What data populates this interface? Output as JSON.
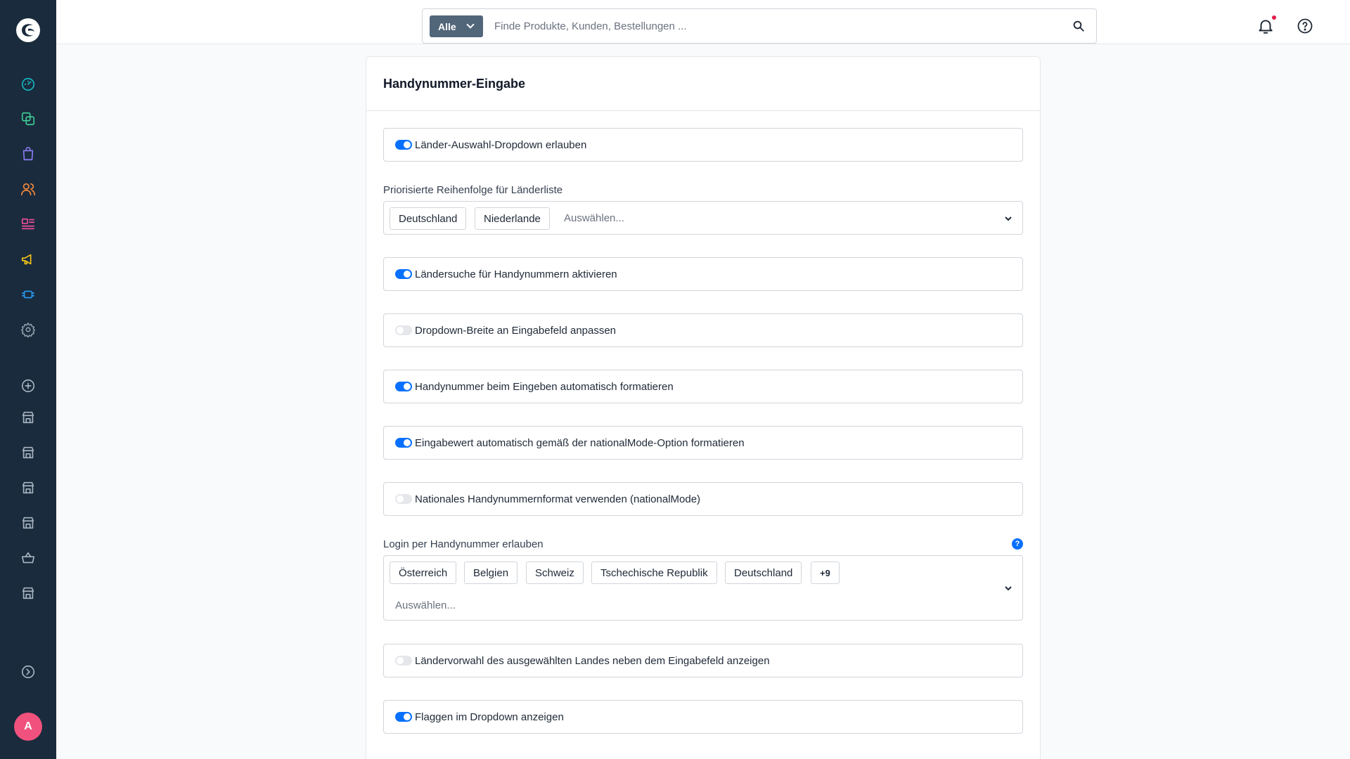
{
  "topbar": {
    "search_scope": "Alle",
    "search_placeholder": "Finde Produkte, Kunden, Bestellungen ..."
  },
  "sidebar": {
    "icons": [
      "dashboard-icon",
      "catalog-icon",
      "orders-icon",
      "customers-icon",
      "content-icon",
      "marketing-icon",
      "extensions-icon",
      "settings-icon",
      "add-sales-channel-icon",
      "sales-channel-icon",
      "sales-channel-icon",
      "sales-channel-icon",
      "sales-channel-icon",
      "basket-icon",
      "sales-channel-icon",
      "more-icon",
      "expand-icon"
    ],
    "avatar_initial": "A"
  },
  "card": {
    "title": "Handynummer-Eingabe",
    "toggles": [
      {
        "label": "Länder-Auswahl-Dropdown erlauben",
        "on": true
      },
      {
        "label": "Ländersuche für Handynummern aktivieren",
        "on": true
      },
      {
        "label": "Dropdown-Breite an Eingabefeld anpassen",
        "on": false
      },
      {
        "label": "Handynummer beim Eingeben automatisch formatieren",
        "on": true
      },
      {
        "label": "Eingabewert automatisch gemäß der nationalMode-Option formatieren",
        "on": true
      },
      {
        "label": "Nationales Handynummernformat verwenden (nationalMode)",
        "on": false
      },
      {
        "label": "Ländervorwahl des ausgewählten Landes neben dem Eingabefeld anzeigen",
        "on": false
      },
      {
        "label": "Flaggen im Dropdown anzeigen",
        "on": true
      }
    ],
    "priority": {
      "label": "Priorisierte Reihenfolge für Länderliste",
      "chips": [
        "Deutschland",
        "Niederlande"
      ],
      "placeholder": "Auswählen..."
    },
    "login": {
      "label": "Login per Handynummer erlauben",
      "chips": [
        "Österreich",
        "Belgien",
        "Schweiz",
        "Tschechische Republik",
        "Deutschland"
      ],
      "more": "+9",
      "placeholder": "Auswählen...",
      "help": "?"
    }
  },
  "colors": {
    "sidebar": "#1a2b3d",
    "accent": "#0870ff",
    "avatar": "#f0527d"
  }
}
